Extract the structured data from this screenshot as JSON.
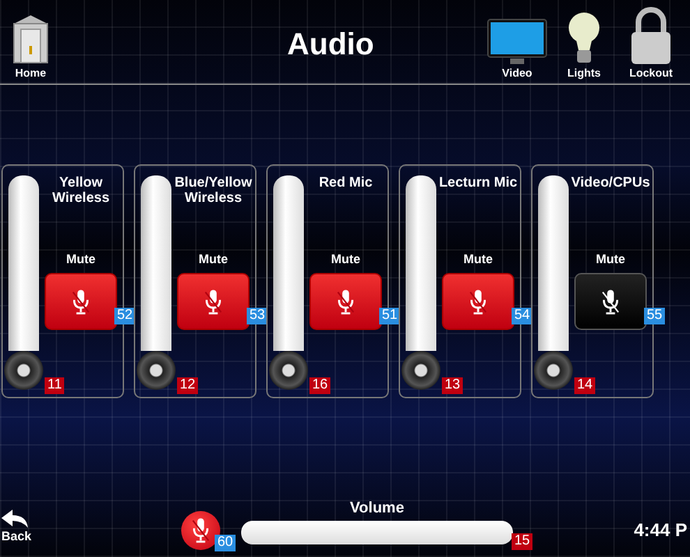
{
  "header": {
    "title": "Audio",
    "home": {
      "label": "Home"
    },
    "nav": [
      {
        "label": "Video"
      },
      {
        "label": "Lights"
      },
      {
        "label": "Lockout"
      }
    ]
  },
  "channels": [
    {
      "name": "Yellow Wireless",
      "mute_label": "Mute",
      "muted": true,
      "level": 0,
      "fader_number": "11",
      "mute_number": "52"
    },
    {
      "name": "Blue/Yellow Wireless",
      "mute_label": "Mute",
      "muted": true,
      "level": 0,
      "fader_number": "12",
      "mute_number": "53"
    },
    {
      "name": "Red Mic",
      "mute_label": "Mute",
      "muted": true,
      "level": 0,
      "fader_number": "16",
      "mute_number": "51"
    },
    {
      "name": "Lecturn Mic",
      "mute_label": "Mute",
      "muted": true,
      "level": 0,
      "fader_number": "13",
      "mute_number": "54"
    },
    {
      "name": "Video/CPUs",
      "mute_label": "Mute",
      "muted": false,
      "level": 0,
      "fader_number": "14",
      "mute_number": "55"
    }
  ],
  "footer": {
    "back": {
      "label": "Back"
    },
    "master": {
      "label": "Volume",
      "muted": true,
      "level": 1,
      "mute_number": "60",
      "volume_number": "15"
    },
    "time": "4:44 P"
  }
}
